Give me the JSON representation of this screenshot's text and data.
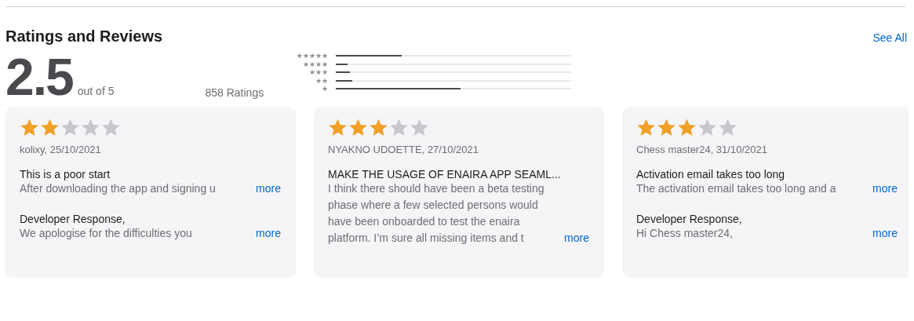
{
  "section": {
    "title": "Ratings and Reviews",
    "see_all": "See All"
  },
  "summary": {
    "average": "2.5",
    "out_of": "out of 5",
    "count": "858 Ratings"
  },
  "histogram": [
    {
      "label": "★★★★★",
      "level": 0.28
    },
    {
      "label": "★★★★",
      "level": 0.05
    },
    {
      "label": "★★★",
      "level": 0.06
    },
    {
      "label": "★★",
      "level": 0.07
    },
    {
      "label": "★",
      "level": 0.53
    }
  ],
  "reviews": [
    {
      "stars": 2,
      "author": "kolixy, 25/10/2021",
      "title": "This is a poor start",
      "body": "After downloading the app and signing u",
      "more": "more",
      "developer_response": {
        "label": "Developer Response,",
        "body": "We apologise for the difficulties you",
        "more": "more"
      }
    },
    {
      "stars": 3,
      "author": "NYAKNO UDOETTE, 27/10/2021",
      "title": "MAKE THE USAGE OF ENAIRA APP SEAML...",
      "body": "I think there should have been a beta testing phase where a few selected persons would have been onboarded to test the enaira platform. I’m sure all missing items and t",
      "more": "more"
    },
    {
      "stars": 3,
      "author": "Chess master24, 31/10/2021",
      "title": "Activation email takes too long",
      "body": "The activation email takes too long and a",
      "more": "more",
      "developer_response": {
        "label": "Developer Response,",
        "body": "Hi Chess master24,",
        "more": "more"
      }
    }
  ]
}
